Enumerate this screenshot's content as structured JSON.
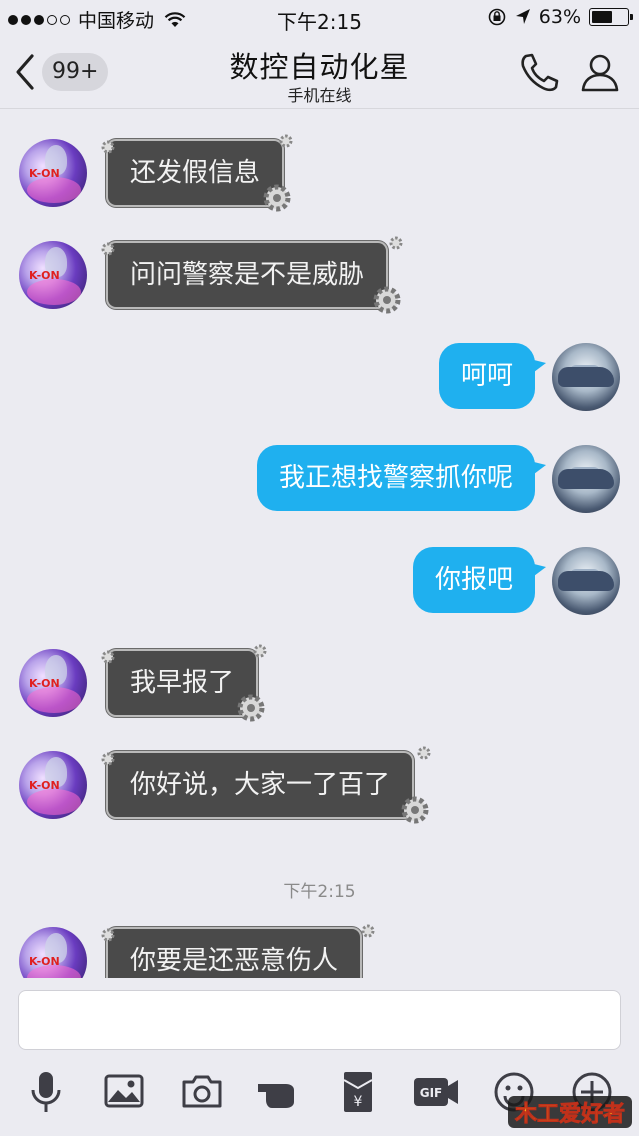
{
  "status_bar": {
    "carrier": "中国移动",
    "time": "下午2:15",
    "battery": "63%",
    "battery_level": 0.63
  },
  "nav": {
    "back_badge": "99+",
    "title": "数控自动化星",
    "subtitle": "手机在线"
  },
  "messages": [
    {
      "side": "left",
      "text": "还发假信息"
    },
    {
      "side": "left",
      "text": "问问警察是不是威胁"
    },
    {
      "side": "right",
      "text": "呵呵"
    },
    {
      "side": "right",
      "text": "我正想找警察抓你呢"
    },
    {
      "side": "right",
      "text": "你报吧"
    },
    {
      "side": "left",
      "text": "我早报了"
    },
    {
      "side": "left",
      "text": "你好说，大家一了百了"
    },
    {
      "side": "left",
      "text": "你要是还恶意伤人"
    }
  ],
  "timestamp": "下午2:15",
  "avatar_left_text": "K-ON",
  "input": {
    "placeholder": ""
  },
  "toolbar": [
    "microphone-icon",
    "image-icon",
    "camera-icon",
    "poke-icon",
    "red-packet-icon",
    "gif-icon",
    "emoji-icon",
    "plus-icon"
  ],
  "watermark": "木工爱好者",
  "colors": {
    "bubble_blue": "#1fb0ef",
    "bubble_dark": "#4a4a4a",
    "background": "#ebebf1"
  }
}
